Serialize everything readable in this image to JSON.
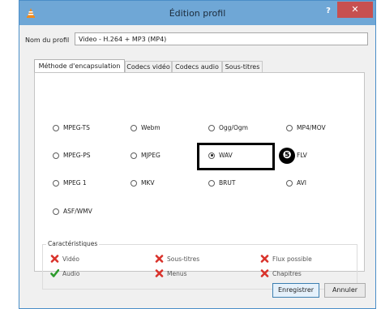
{
  "window": {
    "title": "Édition profil",
    "help_label": "?",
    "close_label": "✕"
  },
  "profile": {
    "label": "Nom du profil",
    "value": "Video - H.264 + MP3 (MP4)"
  },
  "tabs": [
    {
      "label": "Méthode d'encapsulation",
      "active": true
    },
    {
      "label": "Codecs vidéo",
      "active": false
    },
    {
      "label": "Codecs audio",
      "active": false
    },
    {
      "label": "Sous-titres",
      "active": false
    }
  ],
  "encapsulation": [
    {
      "label": "MPEG-TS",
      "checked": false
    },
    {
      "label": "Webm",
      "checked": false
    },
    {
      "label": "Ogg/Ogm",
      "checked": false
    },
    {
      "label": "MP4/MOV",
      "checked": false
    },
    {
      "label": "MPEG-PS",
      "checked": false
    },
    {
      "label": "MJPEG",
      "checked": false
    },
    {
      "label": "WAV",
      "checked": true
    },
    {
      "label": "FLV",
      "checked": false
    },
    {
      "label": "MPEG 1",
      "checked": false
    },
    {
      "label": "MKV",
      "checked": false
    },
    {
      "label": "BRUT",
      "checked": false
    },
    {
      "label": "AVI",
      "checked": false
    },
    {
      "label": "ASF/WMV",
      "checked": false
    }
  ],
  "annotation": {
    "step": "❺"
  },
  "features": {
    "title": "Caractéristiques",
    "items": [
      {
        "label": "Vidéo",
        "supported": false
      },
      {
        "label": "Sous-titres",
        "supported": false
      },
      {
        "label": "Flux possible",
        "supported": false
      },
      {
        "label": "Audio",
        "supported": true
      },
      {
        "label": "Menus",
        "supported": false
      },
      {
        "label": "Chapitres",
        "supported": false
      }
    ]
  },
  "buttons": {
    "save": "Enregistrer",
    "cancel": "Annuler"
  },
  "colors": {
    "titlebar": "#6fa7d6",
    "close": "#c75050",
    "cross": "#d9322b",
    "check": "#2e9b2e"
  }
}
